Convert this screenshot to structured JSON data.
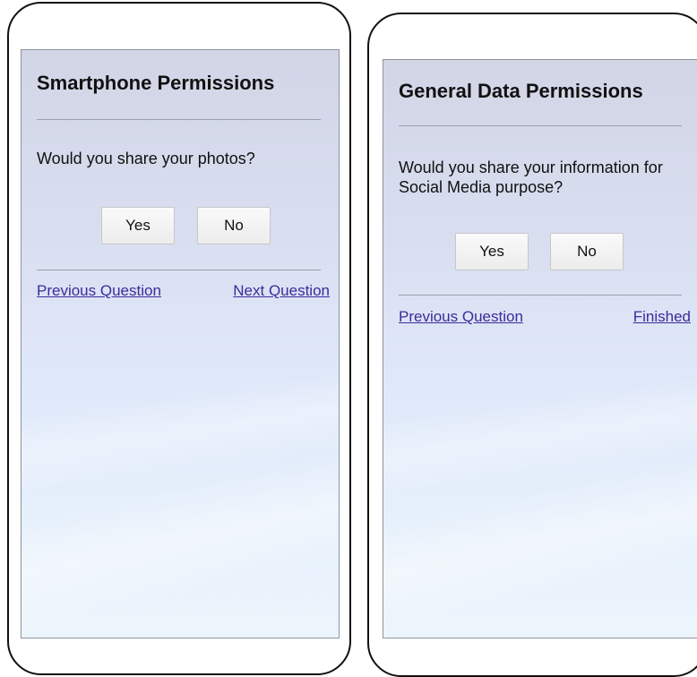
{
  "screens": [
    {
      "title": "Smartphone Permissions",
      "question": "Would you share your photos?",
      "yes_label": "Yes",
      "no_label": "No",
      "prev_label": "Previous Question",
      "next_label": "Next Question"
    },
    {
      "title": "General Data Permissions",
      "question": "Would you share your information for Social Media purpose?",
      "yes_label": "Yes",
      "no_label": "No",
      "prev_label": "Previous Question",
      "next_label": "Finished"
    }
  ],
  "colors": {
    "link": "#3d2a9a",
    "screen_top": "#d2d5e6",
    "screen_bottom": "#edf5fc",
    "phone_border": "#111111"
  }
}
